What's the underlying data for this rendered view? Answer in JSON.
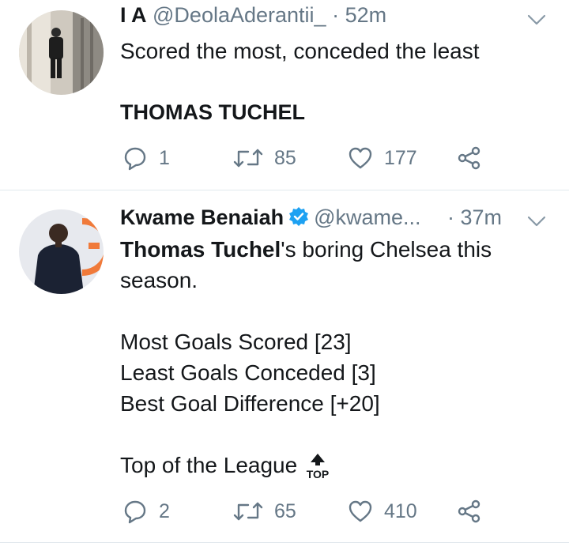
{
  "tweets": [
    {
      "name": "I A",
      "handle": "@DeolaAderantii_",
      "time": "· 52m",
      "text_line1": "Scored the most, conceded the least",
      "text_line2": "THOMAS TUCHEL",
      "replies": "1",
      "retweets": "85",
      "likes": "177"
    },
    {
      "name": "Kwame Benaiah",
      "handle": "@kwame...",
      "time": "· 37m",
      "text_bold": "Thomas Tuchel",
      "text_line1_rest": "'s boring Chelsea this",
      "text_line2": "season.",
      "stat1": "Most Goals Scored [23]",
      "stat2": "Least Goals Conceded [3]",
      "stat3": "Best Goal Difference [+20]",
      "closing": "Top of the League",
      "emoji_text": "TOP",
      "replies": "2",
      "retweets": "65",
      "likes": "410"
    }
  ],
  "icons": {
    "reply": "reply-icon",
    "retweet": "retweet-icon",
    "like": "heart-icon",
    "share": "share-icon",
    "caret": "chevron-down-icon",
    "verified": "verified-badge-icon"
  },
  "colors": {
    "text": "#14171a",
    "muted": "#657786",
    "verified": "#1da1f2",
    "divider": "#e1e8ed"
  }
}
